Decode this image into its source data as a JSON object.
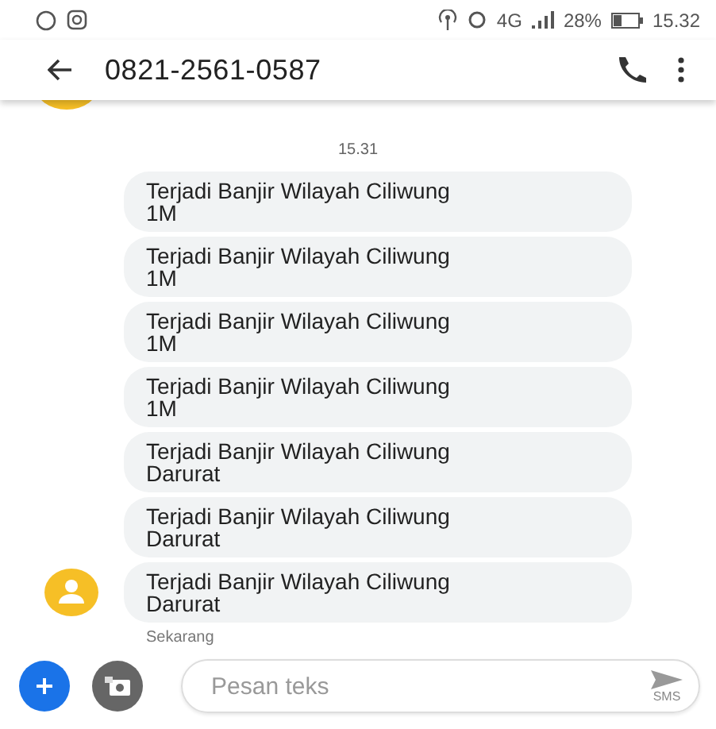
{
  "status_bar": {
    "network": "4G",
    "battery": "28%",
    "time": "15.32"
  },
  "header": {
    "title": "0821-2561-0587"
  },
  "timestamp": "15.31",
  "messages": [
    {
      "text": "Terjadi Banjir Wilayah Ciliwung 1M",
      "avatar": false
    },
    {
      "text": "Terjadi Banjir Wilayah Ciliwung 1M",
      "avatar": false
    },
    {
      "text": "Terjadi Banjir Wilayah Ciliwung 1M",
      "avatar": false
    },
    {
      "text": "Terjadi Banjir Wilayah Ciliwung 1M",
      "avatar": false
    },
    {
      "text": "Terjadi Banjir Wilayah Ciliwung Darurat",
      "avatar": false
    },
    {
      "text": "Terjadi Banjir Wilayah Ciliwung Darurat",
      "avatar": false
    },
    {
      "text": "Terjadi Banjir Wilayah Ciliwung Darurat",
      "avatar": true
    }
  ],
  "status": "Sekarang",
  "composer": {
    "placeholder": "Pesan teks",
    "send_label": "SMS"
  }
}
